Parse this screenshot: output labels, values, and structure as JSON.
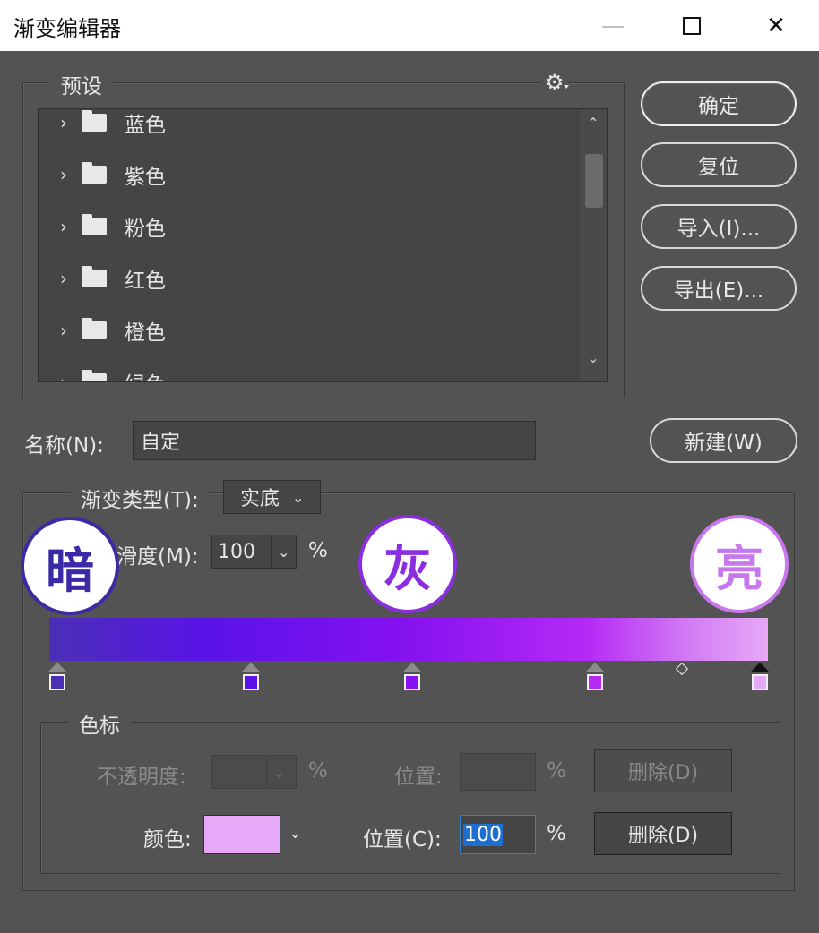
{
  "window": {
    "title": "渐变编辑器",
    "min_glyph": "—",
    "close_glyph": "✕"
  },
  "presets": {
    "legend": "预设",
    "gear": "⚙",
    "items": [
      {
        "label": "蓝色"
      },
      {
        "label": "紫色"
      },
      {
        "label": "粉色"
      },
      {
        "label": "红色"
      },
      {
        "label": "橙色"
      },
      {
        "label": "绿色"
      }
    ],
    "scroll_up": "⌃",
    "scroll_down": "⌄"
  },
  "buttons": {
    "ok": "确定",
    "reset": "复位",
    "import": "导入(I)...",
    "export": "导出(E)...",
    "new": "新建(W)"
  },
  "name": {
    "label": "名称(N):",
    "value": "自定"
  },
  "gradient_type": {
    "label": "渐变类型(T):",
    "value": "实底"
  },
  "smoothness": {
    "label": "滑度(M):",
    "value": "100",
    "unit": "%"
  },
  "badges": {
    "dark": {
      "text": "暗",
      "color": "#3b2aa6"
    },
    "gray": {
      "text": "灰",
      "color": "#8a2ee0"
    },
    "light": {
      "text": "亮",
      "color": "#c877ee"
    }
  },
  "color_stops": [
    {
      "position": 0,
      "color": "#4b2fb3"
    },
    {
      "position": 27.5,
      "color": "#5b12e6"
    },
    {
      "position": 50.5,
      "color": "#8612f0"
    },
    {
      "position": 76.5,
      "color": "#b52af5"
    },
    {
      "position": 100,
      "color": "#e6a8f7",
      "selected": true
    }
  ],
  "stops_section": {
    "legend": "色标",
    "opacity_label": "不透明度:",
    "opacity_unit": "%",
    "position_label_disabled": "位置:",
    "position_unit": "%",
    "delete_disabled": "删除(D)",
    "color_label": "颜色:",
    "color_value": "#e6a8f7",
    "position_label": "位置(C):",
    "position_value": "100",
    "delete": "删除(D)"
  }
}
